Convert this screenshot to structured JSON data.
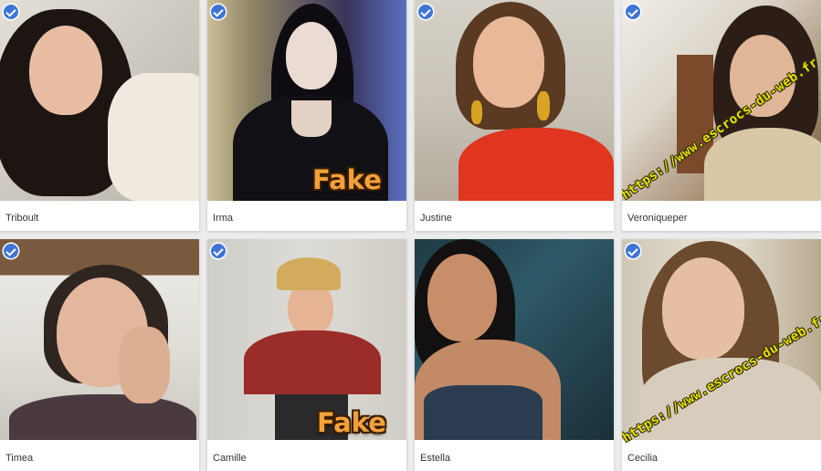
{
  "profiles": [
    {
      "name": "Triboult",
      "verified": true,
      "overlay": ""
    },
    {
      "name": "Irma",
      "verified": true,
      "overlay": "Fake"
    },
    {
      "name": "Justine",
      "verified": true,
      "overlay": ""
    },
    {
      "name": "Veroniqueper",
      "verified": true,
      "overlay": "watermark"
    },
    {
      "name": "Timea",
      "verified": true,
      "overlay": ""
    },
    {
      "name": "Camille",
      "verified": true,
      "overlay": "Fake"
    },
    {
      "name": "Estella",
      "verified": false,
      "overlay": ""
    },
    {
      "name": "Cecilia",
      "verified": true,
      "overlay": "watermark"
    }
  ],
  "overlays": {
    "fake_label": "Fake",
    "watermark_text": "https://www.escrocs-du-web.fr"
  },
  "colors": {
    "badge": "#3f74d6",
    "fake_text": "#f2a13a",
    "watermark_text": "#e8e000",
    "background": "#ececec"
  },
  "icons": {
    "verified": "verified-check-icon"
  }
}
